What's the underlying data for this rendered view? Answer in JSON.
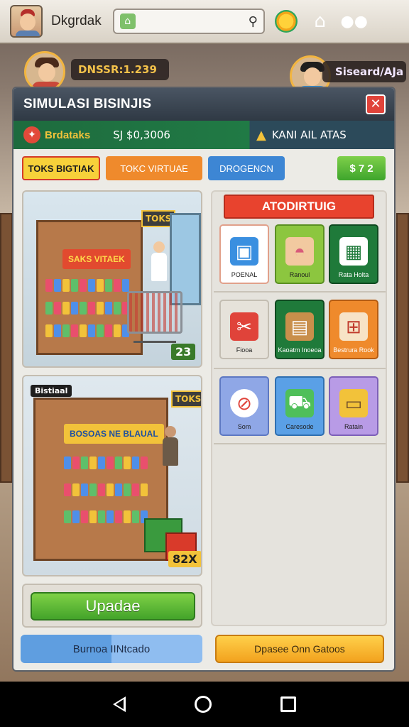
{
  "topbar": {
    "player_name": "Dkgrdak",
    "search_placeholder": "",
    "icons": [
      "avatar",
      "home-badge-icon",
      "search-icon",
      "sun-reward-icon",
      "building-icon",
      "friends-icon"
    ]
  },
  "friends": {
    "left_tag": "DNSSR:1.239",
    "right_tag": "Siseard/AJa"
  },
  "panel": {
    "title": "SIMULASI BISINJIS",
    "close_label": "✕",
    "status": {
      "store_name": "Brdataks",
      "money": "SJ $0,3006",
      "warning": "KANI AIL ATAS"
    },
    "tabs": [
      "TOKS BIGTIAK",
      "TOKC VIRTUAE",
      "DROGENCN"
    ],
    "balance": "$ 7 2",
    "scene1": {
      "sign": "SAKS VITAEK",
      "side_sign": "TOKS",
      "price": "23"
    },
    "scene2": {
      "badge": "Bistiaal",
      "sign": "BOSOAS NE BLAUAL",
      "side_sign": "TOKS",
      "price": "82X"
    },
    "update_label": "Upadae",
    "bottom_left": "Burnoa IINtcado",
    "bottom_right": "Dpasee Onn Gatoos",
    "features": {
      "title": "ATODIRTUIG",
      "tiles": [
        {
          "label": "POENAL",
          "icon": "box-icon"
        },
        {
          "label": "Ranoul",
          "icon": "cake-icon"
        },
        {
          "label": "Rata Holta",
          "icon": "building-grid-icon"
        },
        {
          "label": "Fiooa",
          "icon": "shopping-bag-icon"
        },
        {
          "label": "Kaoatm Inoeoa",
          "icon": "cash-register-icon"
        },
        {
          "label": "Bestrura Rook",
          "icon": "shopping-cart-icon"
        },
        {
          "label": "Som",
          "icon": "no-entry-icon"
        },
        {
          "label": "Caresode",
          "icon": "delivery-icon"
        },
        {
          "label": "Ratain",
          "icon": "suitcase-icon"
        }
      ]
    }
  },
  "colors": {
    "header": "#2f3944",
    "status_green": "#207a45",
    "close_red": "#e0433a",
    "update_green": "#43a32a",
    "accent_orange": "#f2a21e"
  }
}
